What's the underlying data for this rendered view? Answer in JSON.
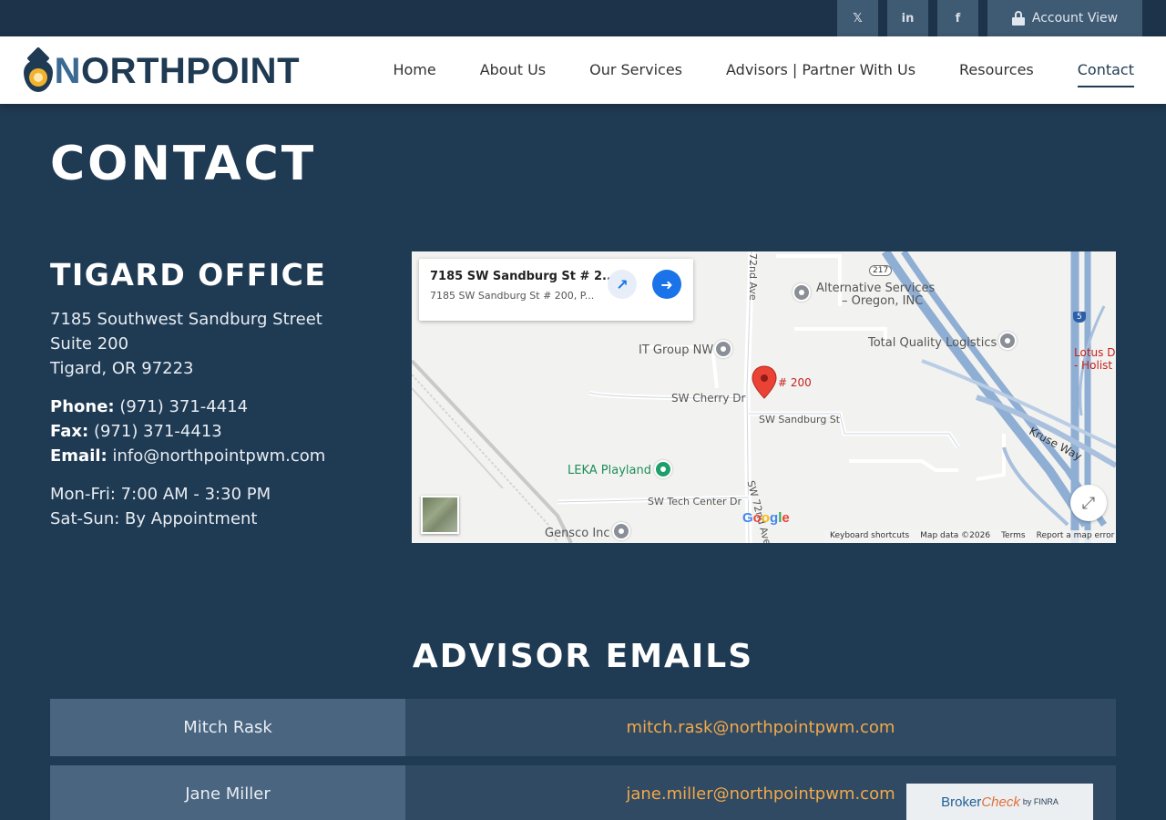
{
  "topbar": {
    "social": [
      {
        "name": "x",
        "glyph": "𝕏"
      },
      {
        "name": "linkedin",
        "glyph": "in"
      },
      {
        "name": "facebook",
        "glyph": "f"
      }
    ],
    "account_label": "Account View"
  },
  "nav": {
    "logo_text_n": "N",
    "logo_text_rest": "ORTHPOINT",
    "items": [
      "Home",
      "About Us",
      "Our Services",
      "Advisors | Partner With Us",
      "Resources",
      "Contact"
    ],
    "active": "Contact"
  },
  "page": {
    "title": "CONTACT"
  },
  "office": {
    "heading": "TIGARD OFFICE",
    "address_line1": "7185 Southwest Sandburg Street",
    "address_line2": "Suite 200",
    "address_line3": "Tigard, OR 97223",
    "phone_label": "Phone:",
    "phone": "(971) 371-4414",
    "fax_label": "Fax:",
    "fax": "(971) 371-4413",
    "email_label": "Email:",
    "email": "info@northpointpwm.com",
    "hours_weekday": "Mon-Fri: 7:00 AM - 3:30 PM",
    "hours_weekend": "Sat-Sun: By Appointment"
  },
  "map": {
    "info_title": "7185 SW Sandburg St # 2...",
    "info_subtitle": "7185 SW Sandburg St # 200, P...",
    "labels": {
      "alt_services": "Alternative Services",
      "alt_services2": "– Oregon, INC",
      "it_group": "IT Group NW",
      "total_quality": "Total Quality Logistics",
      "lotus": "Lotus D",
      "lotus2": "- Holist",
      "cherry": "SW Cherry Dr",
      "sandburg": "SW Sandburg St",
      "pin_label": "# 200",
      "leka": "LEKA Playland",
      "tech_center": "SW Tech Center Dr",
      "gensco": "Gensco Inc",
      "ave72": "72nd Ave",
      "ave72b": "SW 72nd Ave",
      "kruse": "Kruse Way",
      "shield217": "217",
      "shield5": "5"
    },
    "google": "Google",
    "attribution": [
      "Keyboard shortcuts",
      "Map data ©2026",
      "Terms",
      "Report a map error"
    ]
  },
  "advisors": {
    "heading": "ADVISOR EMAILS",
    "rows": [
      {
        "name": "Mitch Rask",
        "email": "mitch.rask@northpointpwm.com"
      },
      {
        "name": "Jane Miller",
        "email": "jane.miller@northpointpwm.com"
      }
    ]
  },
  "brokercheck": {
    "part1": "Broker",
    "part2": "Check",
    "part3": "by FINRA"
  }
}
